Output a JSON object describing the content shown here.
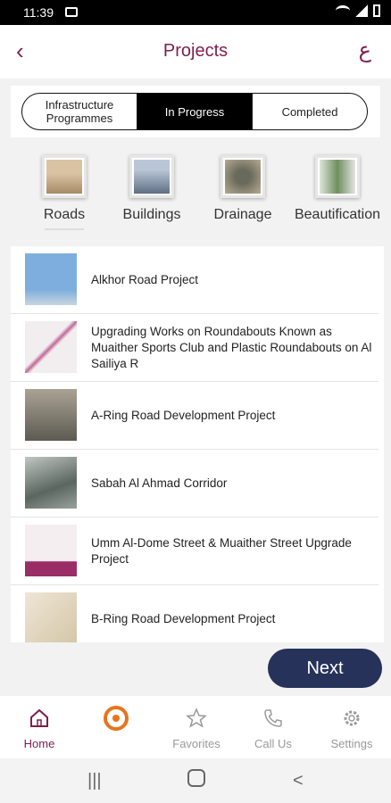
{
  "status": {
    "time": "11:39"
  },
  "header": {
    "title": "Projects",
    "back": "‹",
    "lang": "ع"
  },
  "segments": [
    {
      "label": "Infrastructure Programmes",
      "active": false
    },
    {
      "label": "In Progress",
      "active": true
    },
    {
      "label": "Completed",
      "active": false
    }
  ],
  "categories": [
    {
      "label": "Roads",
      "active": true,
      "color": "#c7a884"
    },
    {
      "label": "Buildings",
      "active": false,
      "color": "#8da0b8"
    },
    {
      "label": "Drainage",
      "active": false,
      "color": "#9a8f78"
    },
    {
      "label": "Beautification",
      "active": false,
      "color": "#7f9b7a"
    }
  ],
  "projects": [
    {
      "name": "Alkhor Road Project",
      "color": "#8fb7dd"
    },
    {
      "name": "Upgrading Works on Roundabouts Known as Muaither Sports Club and Plastic Roundabouts on Al Sailiya R",
      "color": "#d9d0d6"
    },
    {
      "name": "A-Ring Road Development Project",
      "color": "#8b8679"
    },
    {
      "name": "Sabah Al Ahmad Corridor",
      "color": "#7d8a84"
    },
    {
      "name": "Umm Al-Dome Street & Muaither Street Upgrade Project",
      "color": "#d8c4cf"
    },
    {
      "name": "B-Ring Road Development Project",
      "color": "#e1d8c6"
    }
  ],
  "next_label": "Next",
  "tabs": [
    {
      "label": "Home"
    },
    {
      "label": ""
    },
    {
      "label": "Favorites"
    },
    {
      "label": "Call Us"
    },
    {
      "label": "Settings"
    }
  ],
  "colors": {
    "accent": "#7d1f4f",
    "button": "#27325a",
    "brand_orange": "#e8741c"
  }
}
